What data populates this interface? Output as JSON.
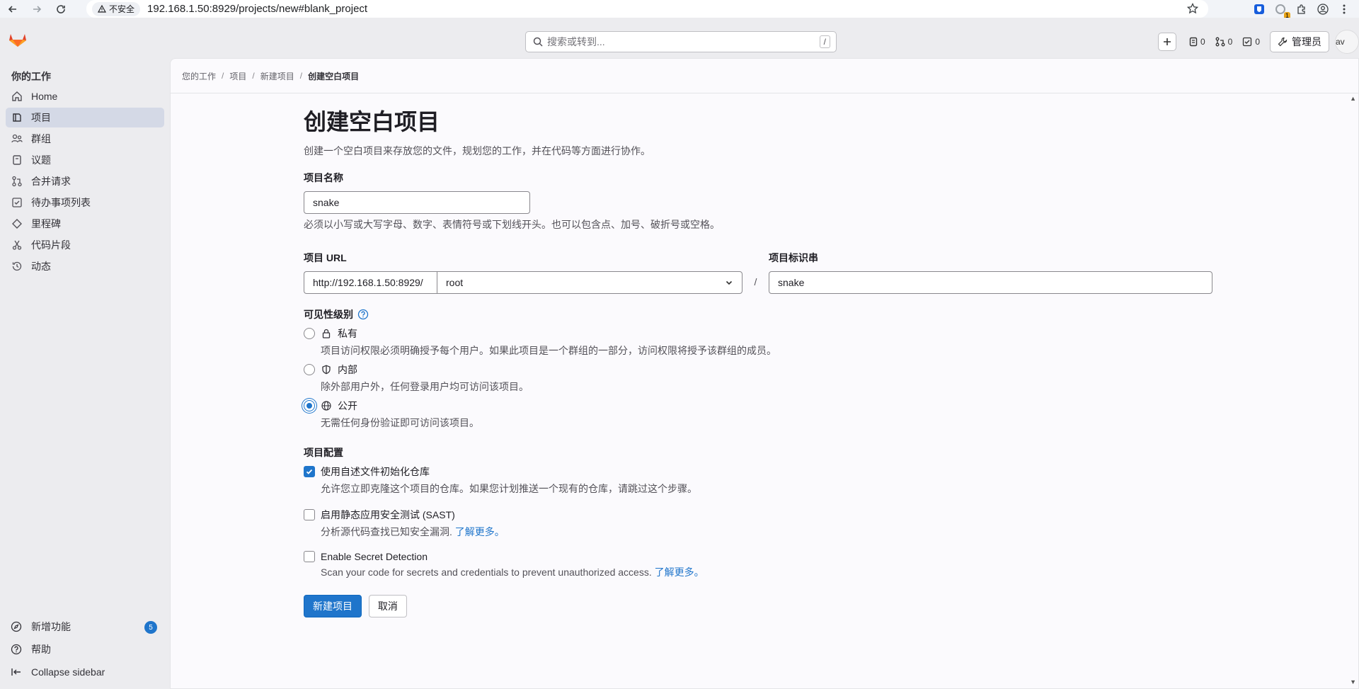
{
  "browser": {
    "security_label": "不安全",
    "url": "192.168.1.50:8929/projects/new#blank_project",
    "extension_badge": "1"
  },
  "topbar": {
    "search_placeholder": "搜索或转到...",
    "search_shortcut": "/",
    "issues_count": "0",
    "merge_requests_count": "0",
    "todos_count": "0",
    "admin_label": "管理员",
    "avatar_alt": "av"
  },
  "sidebar": {
    "title": "你的工作",
    "items": [
      {
        "label": "Home",
        "icon": "home-icon"
      },
      {
        "label": "项目",
        "icon": "project-icon",
        "active": true
      },
      {
        "label": "群组",
        "icon": "group-icon"
      },
      {
        "label": "议题",
        "icon": "issues-icon"
      },
      {
        "label": "合并请求",
        "icon": "merge-request-icon"
      },
      {
        "label": "待办事项列表",
        "icon": "todo-icon"
      },
      {
        "label": "里程碑",
        "icon": "milestone-icon"
      },
      {
        "label": "代码片段",
        "icon": "snippet-icon"
      },
      {
        "label": "动态",
        "icon": "history-icon"
      }
    ],
    "bottom": {
      "whats_new": "新增功能",
      "whats_new_count": "5",
      "help": "帮助",
      "collapse": "Collapse sidebar"
    }
  },
  "breadcrumb": [
    "您的工作",
    "项目",
    "新建项目",
    "创建空白项目"
  ],
  "form": {
    "title": "创建空白项目",
    "description": "创建一个空白项目来存放您的文件，规划您的工作，并在代码等方面进行协作。",
    "name_label": "项目名称",
    "name_value": "snake",
    "name_help": "必须以小写或大写字母、数字、表情符号或下划线开头。也可以包含点、加号、破折号或空格。",
    "url_label": "项目 URL",
    "url_prefix": "http://192.168.1.50:8929/",
    "namespace": "root",
    "url_separator": "/",
    "slug_label": "项目标识串",
    "slug_value": "snake",
    "visibility_label": "可见性级别",
    "visibility": [
      {
        "label": "私有",
        "desc": "项目访问权限必须明确授予每个用户。如果此项目是一个群组的一部分，访问权限将授予该群组的成员。",
        "checked": false
      },
      {
        "label": "内部",
        "desc": "除外部用户外，任何登录用户均可访问该项目。",
        "checked": false
      },
      {
        "label": "公开",
        "desc": "无需任何身份验证即可访问该项目。",
        "checked": true
      }
    ],
    "config_label": "项目配置",
    "readme_label": "使用自述文件初始化仓库",
    "readme_desc": "允许您立即克隆这个项目的仓库。如果您计划推送一个现有的仓库，请跳过这个步骤。",
    "sast_label": "启用静态应用安全测试 (SAST)",
    "sast_desc": "分析源代码查找已知安全漏洞.",
    "sast_link": "了解更多。",
    "secret_label": "Enable Secret Detection",
    "secret_desc": "Scan your code for secrets and credentials to prevent unauthorized access.",
    "secret_link": "了解更多。",
    "create_button": "新建项目",
    "cancel_button": "取消"
  }
}
